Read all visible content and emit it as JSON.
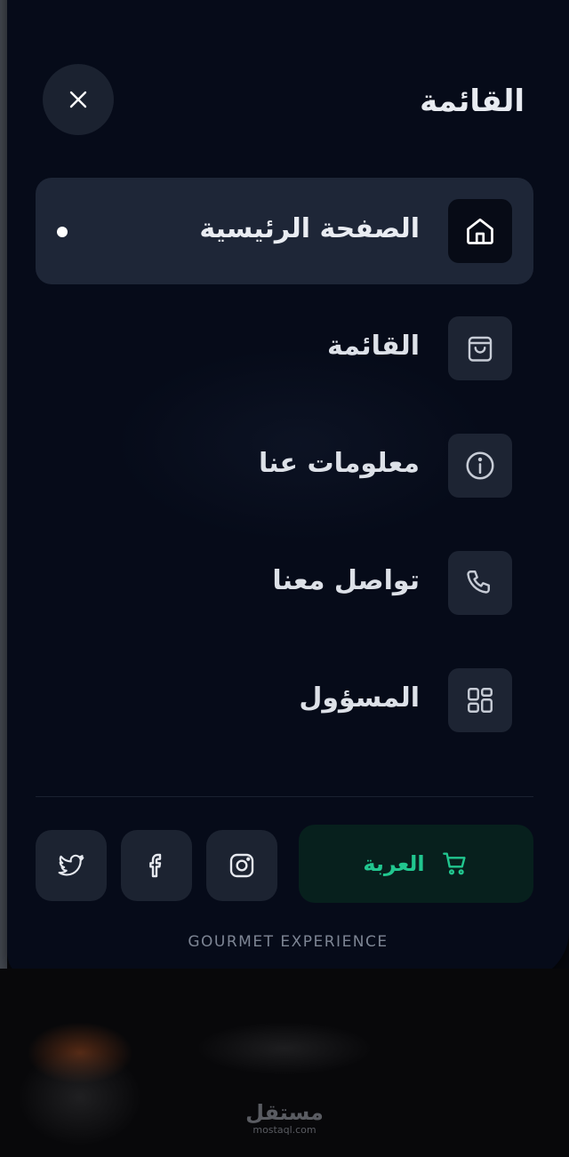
{
  "header": {
    "title": "القائمة"
  },
  "close_button": {
    "icon": "close-icon"
  },
  "nav": {
    "items": [
      {
        "label": "الصفحة الرئيسية",
        "icon": "home-icon",
        "active": true
      },
      {
        "label": "القائمة",
        "icon": "shopping-bag-icon",
        "active": false
      },
      {
        "label": "معلومات عنا",
        "icon": "info-icon",
        "active": false
      },
      {
        "label": "تواصل معنا",
        "icon": "phone-icon",
        "active": false
      },
      {
        "label": "المسؤول",
        "icon": "grid-icon",
        "active": false
      }
    ]
  },
  "footer": {
    "cart_label": "العربة",
    "cart_icon": "cart-icon",
    "social": [
      "instagram-icon",
      "facebook-icon",
      "twitter-icon"
    ],
    "tagline": "GOURMET EXPERIENCE"
  },
  "watermark": {
    "arabic": "مستقل",
    "latin": "mostaql.com"
  },
  "colors": {
    "accent": "#21c68f",
    "panel": "#060b19",
    "item_bg": "#1e2637"
  }
}
